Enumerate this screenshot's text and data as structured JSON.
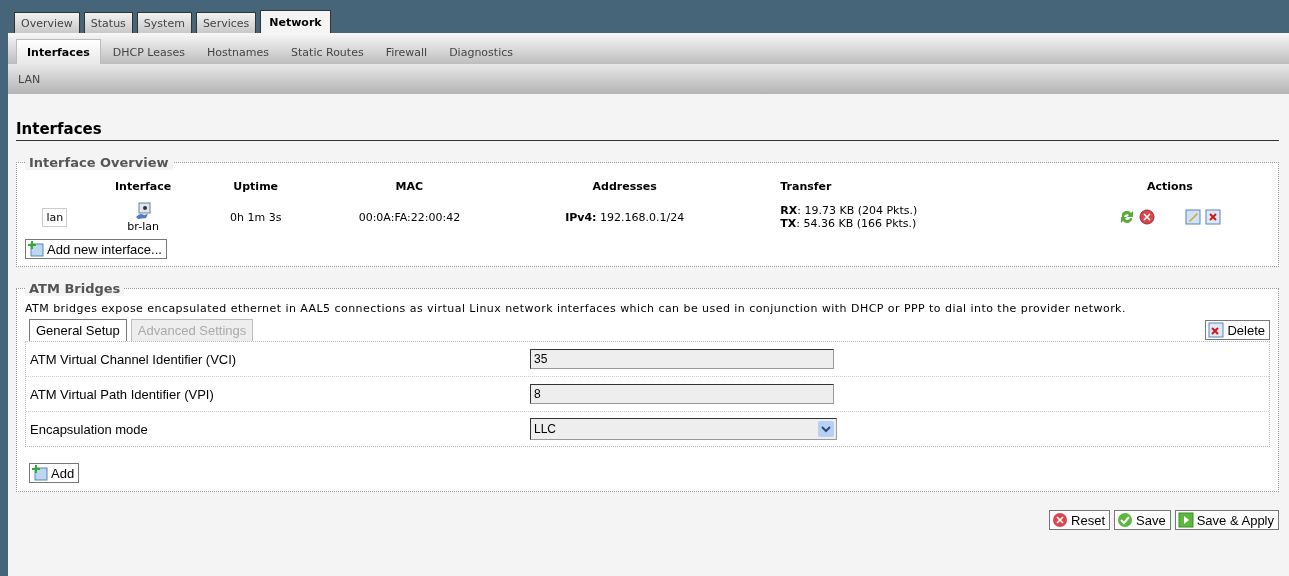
{
  "main_tabs": [
    {
      "label": "Overview",
      "selected": false
    },
    {
      "label": "Status",
      "selected": false
    },
    {
      "label": "System",
      "selected": false
    },
    {
      "label": "Services",
      "selected": false
    },
    {
      "label": "Network",
      "selected": true
    }
  ],
  "sub_tabs": [
    {
      "label": "Interfaces",
      "selected": true
    },
    {
      "label": "DHCP Leases",
      "selected": false
    },
    {
      "label": "Hostnames",
      "selected": false
    },
    {
      "label": "Static Routes",
      "selected": false
    },
    {
      "label": "Firewall",
      "selected": false
    },
    {
      "label": "Diagnostics",
      "selected": false
    }
  ],
  "third_tabs": [
    {
      "label": "LAN",
      "selected": false
    }
  ],
  "page_title": "Interfaces",
  "overview": {
    "legend": "Interface Overview",
    "columns": [
      "Interface",
      "Uptime",
      "MAC",
      "Addresses",
      "Transfer",
      "Actions"
    ],
    "rows": [
      {
        "name": "lan",
        "device": "br-lan",
        "uptime": "0h 1m 3s",
        "mac": "00:0A:FA:22:00:42",
        "addresses": "**IPv4:** 192.168.0.1/24",
        "transfer": [
          "**RX**: 19.73 KB (204 Pkts.)",
          "**TX**: 54.36 KB (166 Pkts.)"
        ]
      }
    ],
    "add_button": "Add new interface..."
  },
  "atm": {
    "legend": "ATM Bridges",
    "description": "ATM bridges expose encapsulated ethernet in AAL5 connections as virtual Linux network interfaces which can be used in conjunction with DHCP or PPP to dial into the provider network.",
    "tabs": [
      {
        "label": "General Setup",
        "selected": true
      },
      {
        "label": "Advanced Settings",
        "selected": false
      }
    ],
    "delete_button": "Delete",
    "fields": [
      {
        "kind": "input",
        "label": "ATM Virtual Channel Identifier (VCI)",
        "value": "35"
      },
      {
        "kind": "input",
        "label": "ATM Virtual Path Identifier (VPI)",
        "value": "8"
      },
      {
        "kind": "select",
        "label": "Encapsulation mode",
        "value": "LLC"
      }
    ],
    "add_button": "Add"
  },
  "footer_buttons": [
    {
      "kind": "reset",
      "label": "Reset"
    },
    {
      "kind": "save",
      "label": "Save"
    },
    {
      "kind": "apply",
      "label": "Save & Apply"
    }
  ]
}
